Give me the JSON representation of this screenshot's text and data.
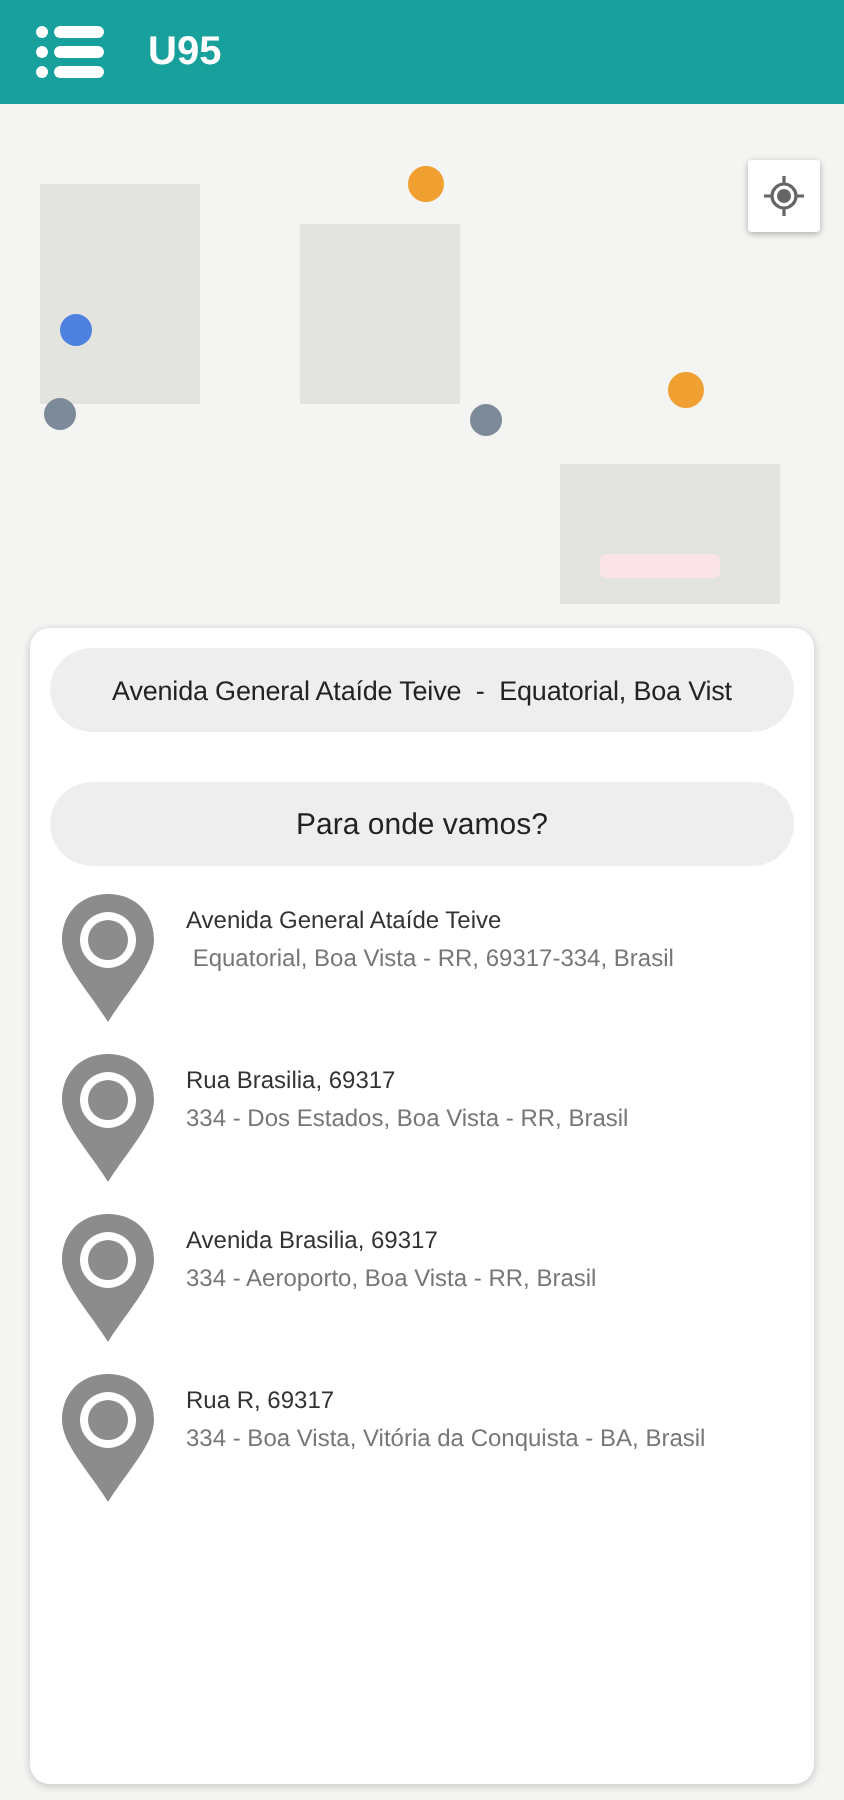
{
  "app_bar": {
    "title": "U95"
  },
  "origin_field": {
    "value": "Avenida General Ataíde Teive  -  Equatorial, Boa Vist"
  },
  "destination_field": {
    "value": "Para onde vamos?"
  },
  "suggestions": [
    {
      "title": "Avenida General Ataíde Teive",
      "address": " Equatorial, Boa Vista - RR, 69317-334, Brasil"
    },
    {
      "title": "Rua Brasilia, 69317",
      "address": "334 - Dos Estados, Boa Vista - RR, Brasil"
    },
    {
      "title": "Avenida Brasilia, 69317",
      "address": "334 - Aeroporto, Boa Vista - RR, Brasil"
    },
    {
      "title": "Rua R, 69317",
      "address": "334 - Boa Vista, Vitória da Conquista - BA, Brasil"
    }
  ]
}
